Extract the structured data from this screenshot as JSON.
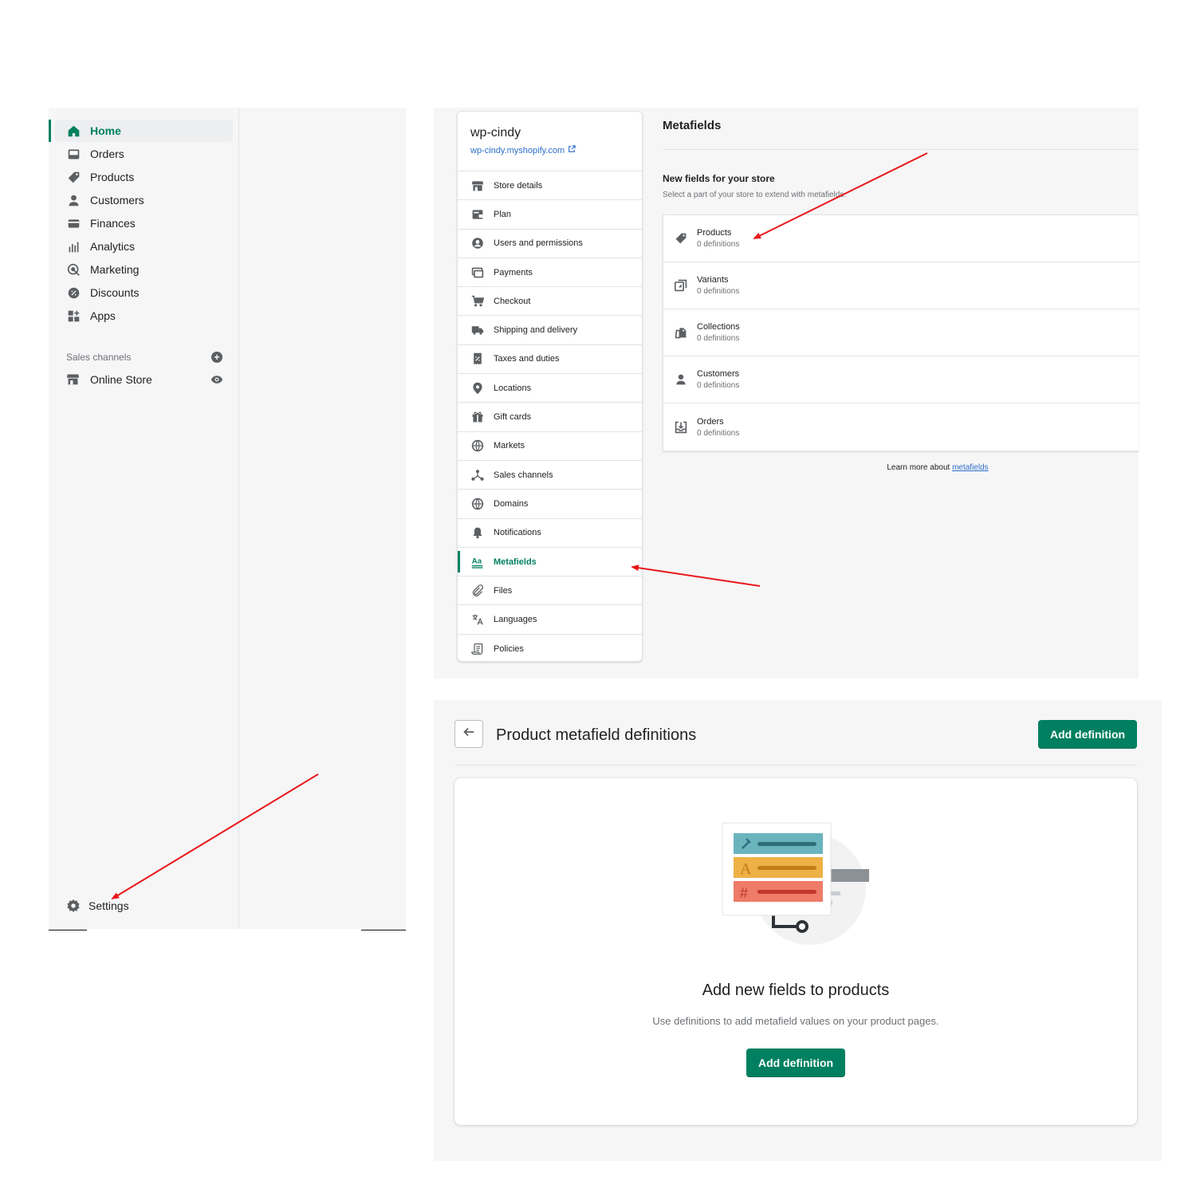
{
  "nav": {
    "items": [
      {
        "label": "Home",
        "icon": "home-icon",
        "active": true
      },
      {
        "label": "Orders",
        "icon": "orders-icon"
      },
      {
        "label": "Products",
        "icon": "tag-icon"
      },
      {
        "label": "Customers",
        "icon": "person-icon"
      },
      {
        "label": "Finances",
        "icon": "finance-icon"
      },
      {
        "label": "Analytics",
        "icon": "analytics-icon"
      },
      {
        "label": "Marketing",
        "icon": "marketing-icon"
      },
      {
        "label": "Discounts",
        "icon": "discount-icon"
      },
      {
        "label": "Apps",
        "icon": "apps-icon"
      }
    ],
    "sales_channels_label": "Sales channels",
    "online_store_label": "Online Store",
    "settings_label": "Settings"
  },
  "settings": {
    "store_name": "wp-cindy",
    "store_url": "wp-cindy.myshopify.com",
    "items": [
      {
        "label": "Store details",
        "icon": "store-icon"
      },
      {
        "label": "Plan",
        "icon": "plan-icon"
      },
      {
        "label": "Users and permissions",
        "icon": "user-circle-icon"
      },
      {
        "label": "Payments",
        "icon": "payments-icon"
      },
      {
        "label": "Checkout",
        "icon": "cart-icon"
      },
      {
        "label": "Shipping and delivery",
        "icon": "truck-icon"
      },
      {
        "label": "Taxes and duties",
        "icon": "tax-icon"
      },
      {
        "label": "Locations",
        "icon": "location-icon"
      },
      {
        "label": "Gift cards",
        "icon": "gift-icon"
      },
      {
        "label": "Markets",
        "icon": "markets-icon"
      },
      {
        "label": "Sales channels",
        "icon": "channels-icon"
      },
      {
        "label": "Domains",
        "icon": "globe-icon"
      },
      {
        "label": "Notifications",
        "icon": "bell-icon"
      },
      {
        "label": "Metafields",
        "icon": "metafields-icon",
        "active": true
      },
      {
        "label": "Files",
        "icon": "paperclip-icon"
      },
      {
        "label": "Languages",
        "icon": "translate-icon"
      },
      {
        "label": "Policies",
        "icon": "policy-icon"
      }
    ]
  },
  "metafields": {
    "title": "Metafields",
    "subtitle": "New fields for your store",
    "description": "Select a part of your store to extend with metafields.",
    "rows": [
      {
        "label": "Products",
        "count": "0 definitions",
        "icon": "tag-icon"
      },
      {
        "label": "Variants",
        "count": "0 definitions",
        "icon": "variants-icon"
      },
      {
        "label": "Collections",
        "count": "0 definitions",
        "icon": "collections-icon"
      },
      {
        "label": "Customers",
        "count": "0 definitions",
        "icon": "person-icon"
      },
      {
        "label": "Orders",
        "count": "0 definitions",
        "icon": "orders-icon"
      }
    ],
    "learn_prefix": "Learn more about ",
    "learn_link": "metafields"
  },
  "definitions": {
    "title": "Product metafield definitions",
    "add_button": "Add definition",
    "empty_heading": "Add new fields to products",
    "empty_text": "Use definitions to add metafield values on your product pages.",
    "empty_button": "Add definition"
  },
  "colors": {
    "accent": "#008060",
    "link": "#2c6ecb",
    "annotation": "#e8181b",
    "bar_teal": "#6ab4be",
    "bar_orange": "#eeb145",
    "bar_red": "#ee7c68"
  }
}
